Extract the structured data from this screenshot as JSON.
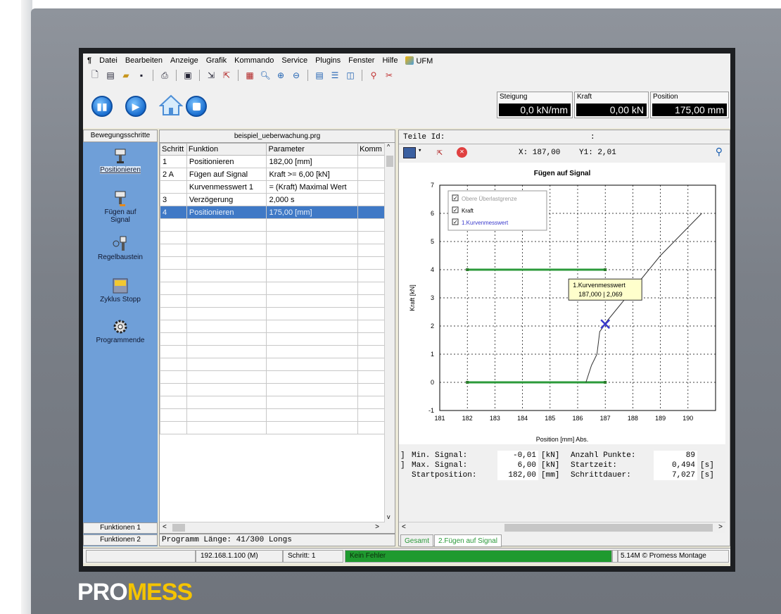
{
  "menu": {
    "items": [
      "Datei",
      "Bearbeiten",
      "Anzeige",
      "Grafik",
      "Kommando",
      "Service",
      "Plugins",
      "Fenster",
      "Hilfe"
    ],
    "ufm": "UFM"
  },
  "displays": {
    "steigung": {
      "label": "Steigung",
      "value": "0,0 kN/mm"
    },
    "kraft": {
      "label": "Kraft",
      "value": "0,00 kN"
    },
    "position": {
      "label": "Position",
      "value": "175,00 mm"
    },
    "value_color": "#ffffff"
  },
  "left_panel": {
    "header": "Bewegungsschritte",
    "items": [
      "Positionieren",
      "Fügen auf Signal",
      "Regelbaustein",
      "Zyklus Stopp",
      "Programmende"
    ],
    "tab1": "Funktionen 1",
    "tab2": "Funktionen 2"
  },
  "program": {
    "title": "beispiel_ueberwachung.prg",
    "columns": [
      "Schritt",
      "Funktion",
      "Parameter",
      "Komm"
    ],
    "rows": [
      [
        "1",
        "Positionieren",
        "182,00 [mm]",
        ""
      ],
      [
        "2 A",
        "Fügen auf Signal",
        "Kraft >= 6,00 [kN]",
        ""
      ],
      [
        "",
        "Kurvenmesswert 1",
        "= (Kraft) Maximal Wert",
        ""
      ],
      [
        "3",
        "Verzögerung",
        "2,000 s",
        ""
      ],
      [
        "4",
        "Positionieren",
        "175,00 [mm]",
        ""
      ]
    ],
    "length": "Programm Länge: 41/300 Longs"
  },
  "chart_panel": {
    "teile_label": "Teile Id:",
    "teile_colon": ":",
    "x_readout": "X: 187,00",
    "y1_readout": "Y1:  2,01",
    "tabs": [
      "Gesamt",
      "2.Fügen auf Signal"
    ]
  },
  "chart_data": {
    "type": "line",
    "title": "Fügen auf Signal",
    "xlabel": "Position [mm] Abs.",
    "ylabel": "Kraft [kN]",
    "xlim": [
      181,
      191
    ],
    "ylim": [
      -1,
      7
    ],
    "xticks": [
      "181",
      "182",
      "183",
      "184",
      "185",
      "186",
      "187",
      "188",
      "189",
      "190"
    ],
    "yticks": [
      "-1",
      "0",
      "1",
      "2",
      "3",
      "4",
      "5",
      "6",
      "7"
    ],
    "grid": true,
    "legend_placement": "top-left",
    "series": [
      {
        "name": "Obere Überlastgrenze",
        "color": "#2b9a3a",
        "x": [
          182,
          187
        ],
        "y": [
          4,
          4
        ]
      },
      {
        "name": "",
        "color": "#2b9a3a",
        "x": [
          182,
          187
        ],
        "y": [
          0,
          0
        ]
      },
      {
        "name": "Kraft",
        "color": "#333333",
        "x": [
          186.3,
          186.5,
          186.7,
          186.8,
          186.95,
          187,
          187.5,
          188,
          188.5,
          189,
          189.5,
          190,
          190.5
        ],
        "y": [
          0,
          0.6,
          1.0,
          1.8,
          2.0,
          2.1,
          2.7,
          3.3,
          3.9,
          4.5,
          5.0,
          5.5,
          6.0
        ]
      },
      {
        "name": "1.Kurvenmesswert",
        "color": "#3a3acc",
        "x": [
          187
        ],
        "y": [
          2.069
        ]
      }
    ],
    "annotation": {
      "title": "1.Kurvenmesswert",
      "text": "187,000 | 2,069",
      "x": 187,
      "y": 2.069
    }
  },
  "info": {
    "min_signal_label": "Min. Signal:",
    "min_signal_value": "-0,01",
    "min_signal_unit": "[kN]",
    "max_signal_label": "Max. Signal:",
    "max_signal_value": "6,00",
    "max_signal_unit": "[kN]",
    "startpos_label": "Startposition:",
    "startpos_value": "182,00",
    "startpos_unit": "[mm]",
    "anzahl_label": "Anzahl Punkte:",
    "anzahl_value": "89",
    "startzeit_label": "Startzeit:",
    "startzeit_value": "0,494",
    "startzeit_unit": "[s]",
    "schritt_label": "Schrittdauer:",
    "schritt_value": "7,027",
    "schritt_unit": "[s]"
  },
  "status": {
    "ip": "192.168.1.100 (M)",
    "schritt": "Schritt: 1",
    "fehler": "Kein Fehler",
    "version": "5.14M © Promess Montage"
  },
  "brand": {
    "part1": "PRO",
    "part2": "MESS"
  }
}
